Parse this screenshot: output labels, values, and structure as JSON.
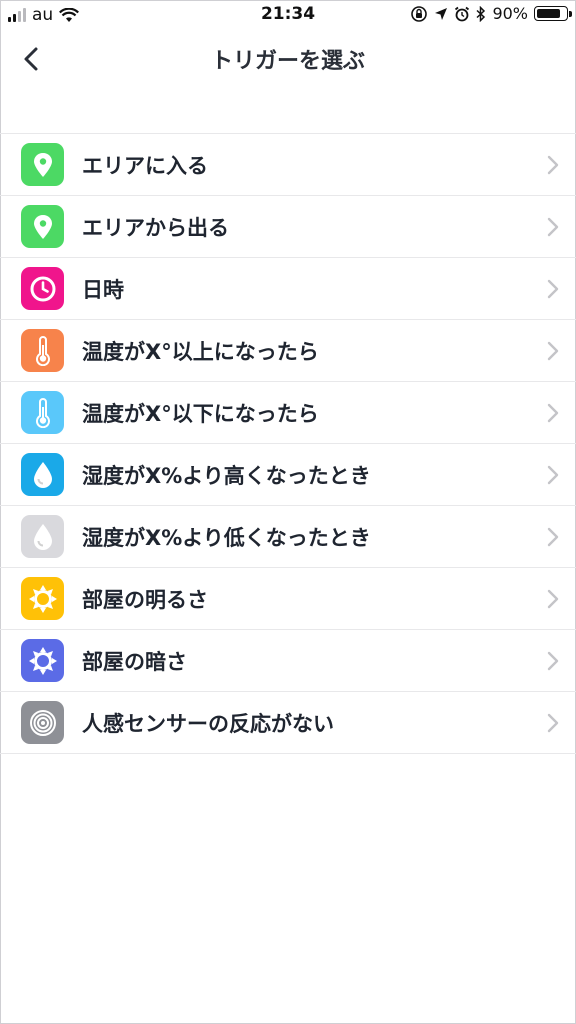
{
  "status_bar": {
    "carrier": "au",
    "time": "21:34",
    "battery_text": "90%",
    "battery_level": 0.9
  },
  "nav": {
    "title": "トリガーを選ぶ",
    "back_icon": "chevron-left-icon"
  },
  "items": [
    {
      "label": "エリアに入る",
      "icon": "location-pin-icon",
      "color": "#4cd964"
    },
    {
      "label": "エリアから出る",
      "icon": "location-pin-icon",
      "color": "#4cd964"
    },
    {
      "label": "日時",
      "icon": "clock-icon",
      "color": "#f0158c"
    },
    {
      "label": "温度がX°以上になったら",
      "icon": "thermometer-icon",
      "color": "#f7834b"
    },
    {
      "label": "温度がX°以下になったら",
      "icon": "thermometer-icon",
      "color": "#5ac8fa"
    },
    {
      "label": "湿度がX%より高くなったとき",
      "icon": "water-drop-icon",
      "color": "#1aa9e8"
    },
    {
      "label": "湿度がX%より低くなったとき",
      "icon": "water-drop-icon",
      "color": "#d9d9dd"
    },
    {
      "label": "部屋の明るさ",
      "icon": "sun-icon",
      "color": "#ffc107"
    },
    {
      "label": "部屋の暗さ",
      "icon": "sun-icon",
      "color": "#5b6be6"
    },
    {
      "label": "人感センサーの反応がない",
      "icon": "motion-sensor-icon",
      "color": "#8e9096"
    }
  ]
}
